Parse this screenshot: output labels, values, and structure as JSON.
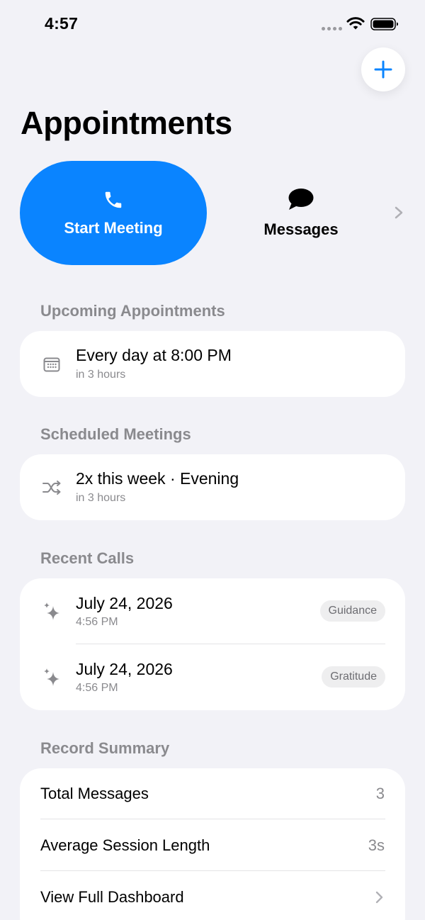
{
  "status_bar": {
    "time": "4:57"
  },
  "page": {
    "title": "Appointments"
  },
  "actions": {
    "start_meeting_label": "Start Meeting",
    "messages_label": "Messages"
  },
  "upcoming": {
    "header": "Upcoming Appointments",
    "item": {
      "title": "Every day at 8:00 PM",
      "subtitle": "in 3 hours",
      "icon": "calendar-icon"
    }
  },
  "scheduled": {
    "header": "Scheduled Meetings",
    "item": {
      "title": "2x this week · Evening",
      "subtitle": "in 3 hours",
      "icon": "shuffle-icon"
    }
  },
  "recent_calls": {
    "header": "Recent Calls",
    "items": [
      {
        "date": "July 24, 2026",
        "time": "4:56 PM",
        "tag": "Guidance",
        "icon": "sparkles-icon"
      },
      {
        "date": "July 24, 2026",
        "time": "4:56 PM",
        "tag": "Gratitude",
        "icon": "sparkles-icon"
      }
    ]
  },
  "summary": {
    "header": "Record Summary",
    "rows": [
      {
        "label": "Total Messages",
        "value": "3"
      },
      {
        "label": "Average Session Length",
        "value": "3s"
      },
      {
        "label": "View Full Dashboard"
      }
    ]
  },
  "colors": {
    "accent": "#0a84ff",
    "background": "#f2f2f7",
    "secondary_text": "#8a8a8e"
  }
}
